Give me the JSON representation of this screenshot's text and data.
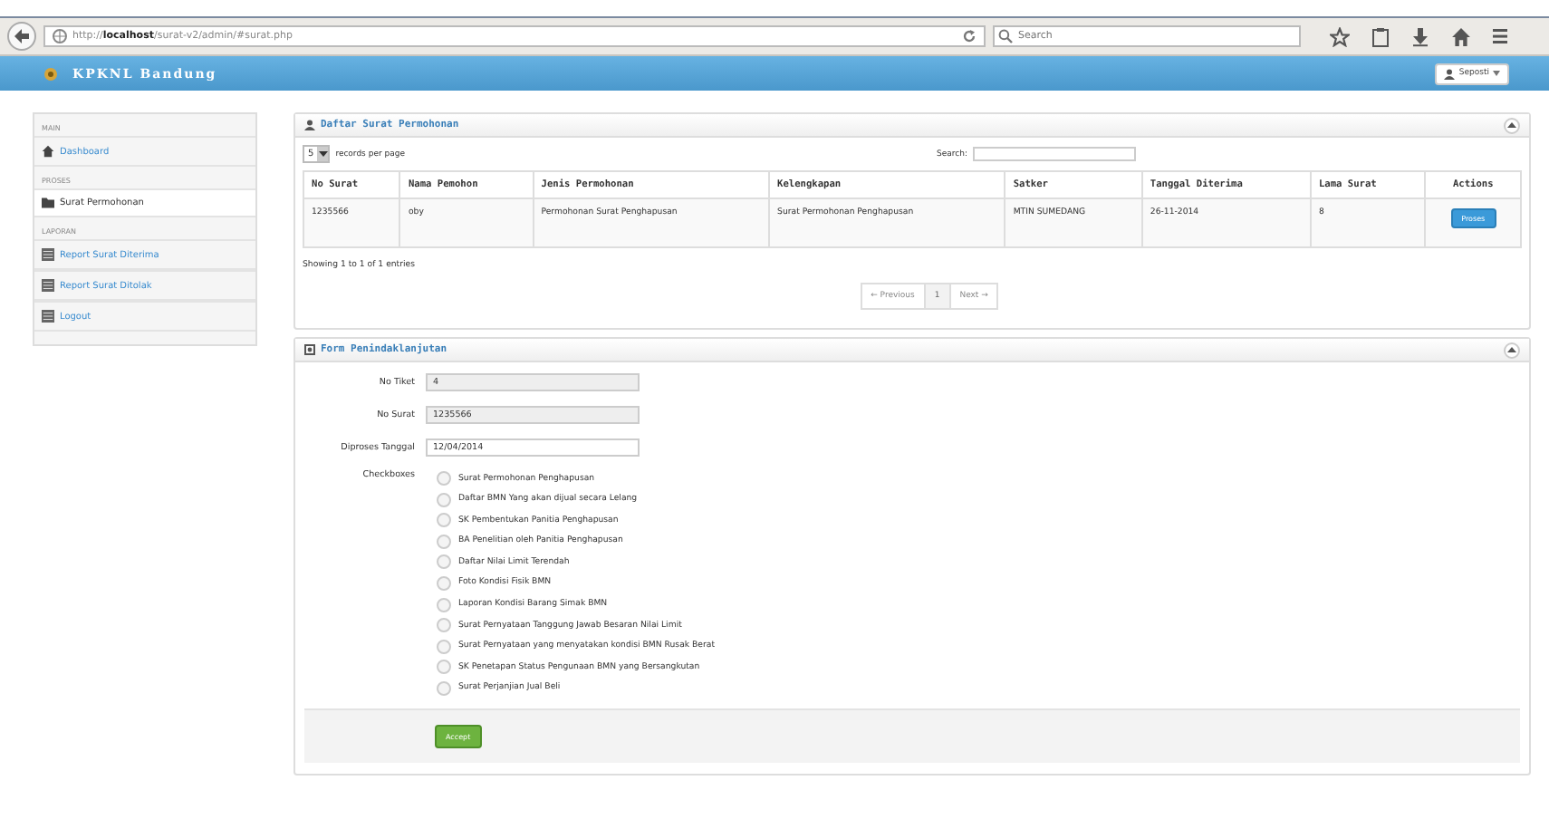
{
  "browser": {
    "url_host_prefix": "http://",
    "url_host": "localhost",
    "url_path": "/surat-v2/admin/#surat.php",
    "search_placeholder": "Search"
  },
  "navbar": {
    "brand": "KPKNL Bandung",
    "user": "Seposti"
  },
  "sidebar": {
    "sections": [
      {
        "heading": "MAIN",
        "items": [
          {
            "label": "Dashboard",
            "kind": "home",
            "selected": false
          }
        ]
      },
      {
        "heading": "PROSES",
        "items": [
          {
            "label": "Surat Permohonan",
            "kind": "folder",
            "selected": true
          }
        ]
      },
      {
        "heading": "LAPORAN",
        "items": [
          {
            "label": "Report Surat Diterima",
            "kind": "list",
            "selected": false
          },
          {
            "label": "Report Surat Ditolak",
            "kind": "list",
            "selected": false
          },
          {
            "label": "Logout",
            "kind": "list",
            "selected": false
          }
        ]
      }
    ]
  },
  "list_panel": {
    "title": "Daftar Surat Permohonan",
    "page_size": "5",
    "page_size_label": "records per page",
    "search_label": "Search:",
    "columns": [
      "No Surat",
      "Nama Pemohon",
      "Jenis Permohonan",
      "Kelengkapan",
      "Satker",
      "Tanggal Diterima",
      "Lama Surat",
      "Actions"
    ],
    "rows": [
      {
        "cells": [
          "1235566",
          "oby",
          "Permohonan Surat Penghapusan",
          "Surat Permohonan Penghapusan",
          "MTIN SUMEDANG",
          "26-11-2014",
          "8"
        ],
        "action": "Proses"
      }
    ],
    "info": "Showing 1 to 1 of 1 entries",
    "pagination": [
      {
        "label": "← Previous",
        "selected": false
      },
      {
        "label": "1",
        "selected": true
      },
      {
        "label": "Next →",
        "selected": false
      }
    ]
  },
  "form_panel": {
    "title": "Form Penindaklanjutan",
    "fields": [
      {
        "label": "No Tiket",
        "value": "4",
        "disabled": true
      },
      {
        "label": "No Surat",
        "value": "1235566",
        "disabled": true
      },
      {
        "label": "Diproses Tanggal",
        "value": "12/04/2014",
        "disabled": false
      }
    ],
    "checkbox_label": "Checkboxes",
    "checkboxes": [
      {
        "label": "Surat Permohonan Penghapusan",
        "checked": false
      },
      {
        "label": "Daftar BMN Yang akan dijual secara Lelang",
        "checked": false
      },
      {
        "label": "SK Pembentukan Panitia Penghapusan",
        "checked": false
      },
      {
        "label": "BA Penelitian oleh Panitia Penghapusan",
        "checked": false
      },
      {
        "label": "Daftar Nilai Limit Terendah",
        "checked": false
      },
      {
        "label": "Foto Kondisi Fisik BMN",
        "checked": false
      },
      {
        "label": "Laporan Kondisi Barang Simak BMN",
        "checked": false
      },
      {
        "label": "Surat Pernyataan Tanggung Jawab Besaran Nilai Limit",
        "checked": false
      },
      {
        "label": "Surat Pernyataan yang menyatakan kondisi BMN Rusak Berat",
        "checked": false
      },
      {
        "label": "SK Penetapan Status Pengunaan BMN yang Bersangkutan",
        "checked": false
      },
      {
        "label": "Surat Perjanjian Jual Beli",
        "checked": false
      }
    ],
    "submit": "Accept"
  }
}
